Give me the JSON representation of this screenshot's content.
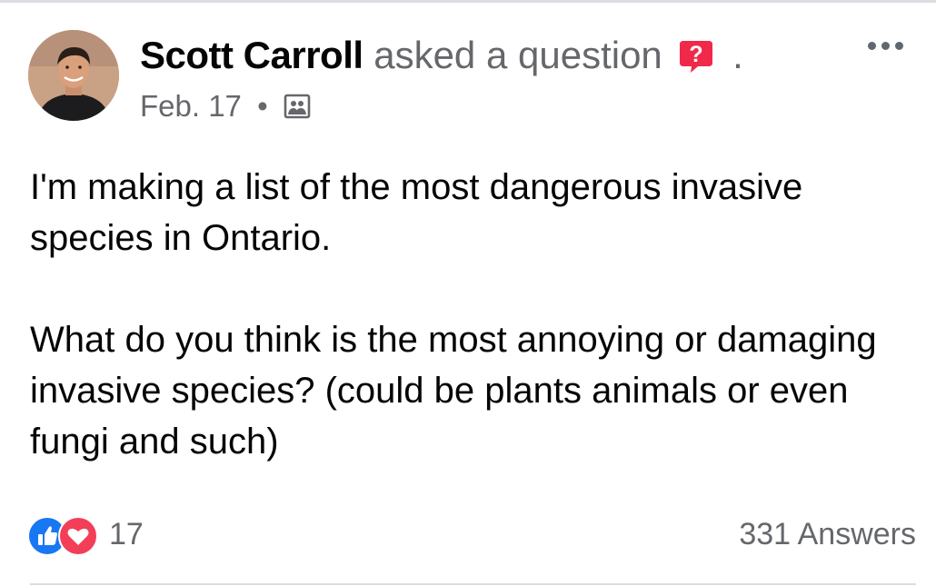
{
  "post": {
    "author": {
      "name": "Scott Carroll",
      "action": "asked a question",
      "trailing": ".",
      "avatar_icon": "profile-photo"
    },
    "meta": {
      "date": "Feb. 17",
      "separator": "•",
      "audience_icon": "group-icon"
    },
    "more_icon": "more-options-icon",
    "body": [
      "I'm making a list of the most dangerous invasive species in Ontario.",
      "What do you think is the most annoying or damaging invasive species? (could be plants animals or even fungi and such)"
    ],
    "reactions": {
      "icons": [
        "like-icon",
        "love-icon"
      ],
      "count": "17"
    },
    "answers": "331 Answers"
  },
  "colors": {
    "like": "#1877f2",
    "love": "#f33e58",
    "question_badge": "#f02849",
    "text_secondary": "#65676b"
  }
}
